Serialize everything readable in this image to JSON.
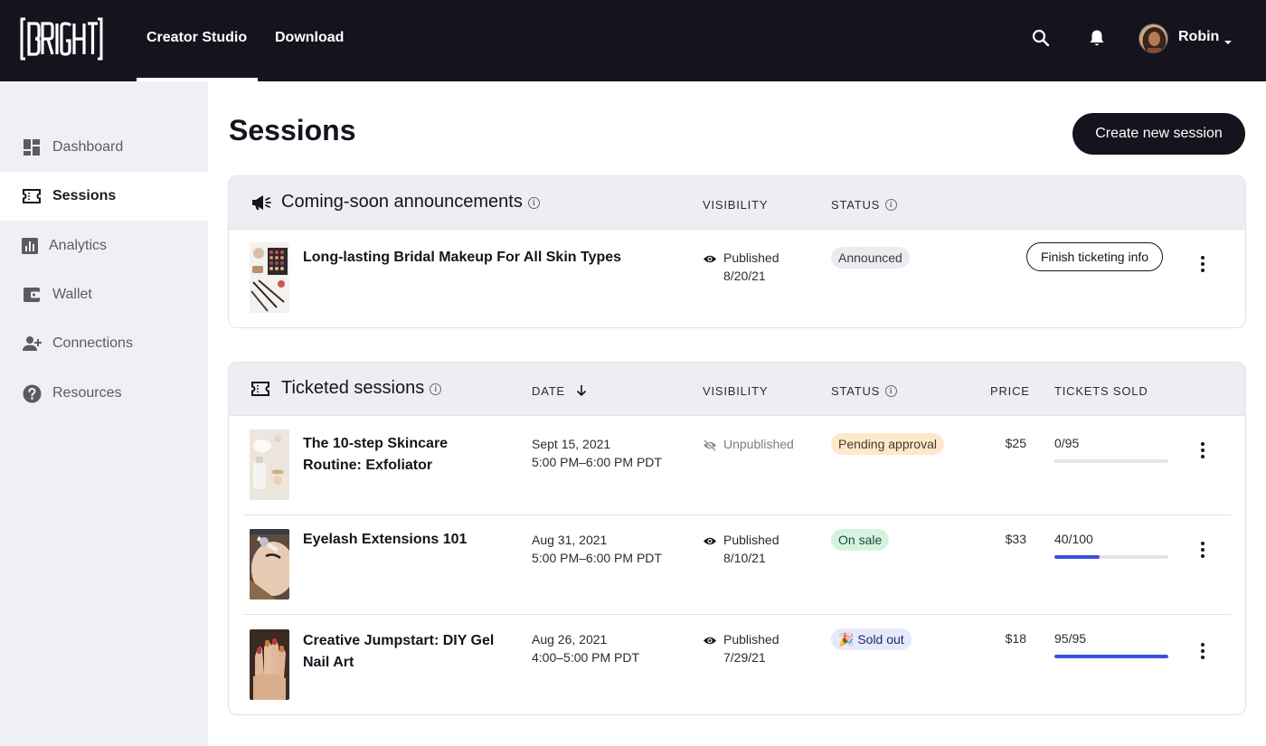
{
  "brand": {
    "logo_text": "BRIGHT"
  },
  "topnav": {
    "tabs": [
      {
        "label": "Creator Studio",
        "active": true
      },
      {
        "label": "Download",
        "active": false
      }
    ],
    "user": {
      "name": "Robin"
    }
  },
  "sidebar": {
    "items": [
      {
        "label": "Dashboard",
        "icon": "dashboard-icon",
        "active": false
      },
      {
        "label": "Sessions",
        "icon": "ticket-icon",
        "active": true
      },
      {
        "label": "Analytics",
        "icon": "analytics-icon",
        "active": false
      },
      {
        "label": "Wallet",
        "icon": "wallet-icon",
        "active": false
      },
      {
        "label": "Connections",
        "icon": "add-person-icon",
        "active": false
      },
      {
        "label": "Resources",
        "icon": "help-icon",
        "active": false
      }
    ]
  },
  "page": {
    "title": "Sessions",
    "create_button": "Create new session"
  },
  "announcements": {
    "title": "Coming-soon announcements",
    "columns": {
      "visibility": "VISIBILITY",
      "status": "STATUS"
    },
    "rows": [
      {
        "title": "Long-lasting Bridal Makeup For All Skin Types",
        "visibility": "Published",
        "visibility_date": "8/20/21",
        "status": "Announced",
        "action": "Finish ticketing info"
      }
    ]
  },
  "ticketed": {
    "title": "Ticketed sessions",
    "columns": {
      "date": "DATE",
      "visibility": "VISIBILITY",
      "status": "STATUS",
      "price": "PRICE",
      "tickets_sold": "TICKETS SOLD"
    },
    "rows": [
      {
        "title": "The 10-step Skincare Routine: Exfoliator",
        "date": "Sept 15, 2021",
        "time": "5:00 PM–6:00 PM PDT",
        "visibility": "Unpublished",
        "visibility_date": "",
        "status": "Pending approval",
        "price": "$25",
        "tickets": "0/95",
        "progress": 0
      },
      {
        "title": "Eyelash Extensions 101",
        "date": "Aug 31, 2021",
        "time": "5:00 PM–6:00 PM PDT",
        "visibility": "Published",
        "visibility_date": "8/10/21",
        "status": "On sale",
        "price": "$33",
        "tickets": "40/100",
        "progress": 0.4
      },
      {
        "title": "Creative Jumpstart: DIY Gel Nail Art",
        "date": "Aug 26, 2021",
        "time": "4:00–5:00 PM PDT",
        "visibility": "Published",
        "visibility_date": "7/29/21",
        "status": "🎉 Sold out",
        "price": "$18",
        "tickets": "95/95",
        "progress": 1
      }
    ]
  },
  "colors": {
    "topbar": "#14141e",
    "accent_progress": "#3b4fe0",
    "badge_announced": "#ececf0",
    "badge_pending": "#fde8cc",
    "badge_on_sale": "#d6f3e2",
    "badge_sold_out": "#e6e8fb"
  }
}
